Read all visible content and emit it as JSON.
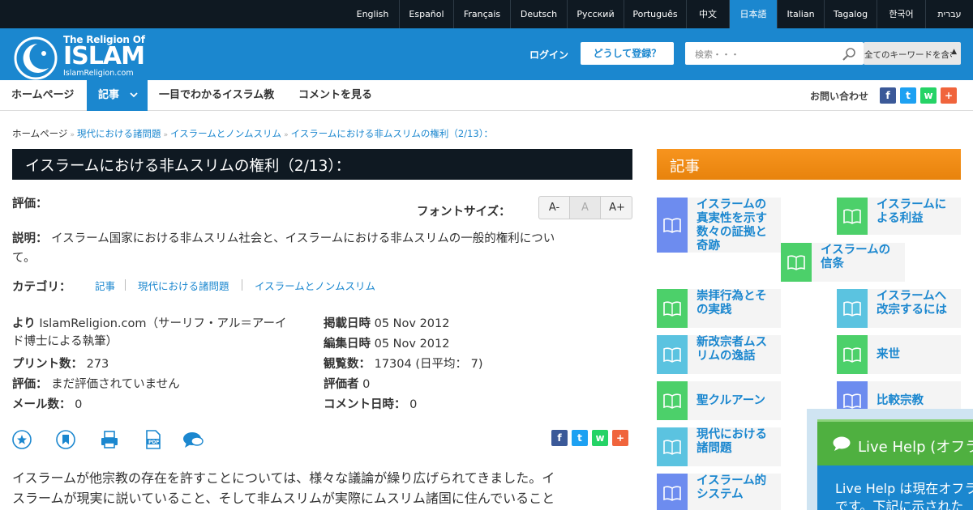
{
  "lang_bar": {
    "languages": [
      {
        "label": "English",
        "active": false
      },
      {
        "label": "Español",
        "active": false
      },
      {
        "label": "Français",
        "active": false
      },
      {
        "label": "Deutsch",
        "active": false
      },
      {
        "label": "Русский",
        "active": false
      },
      {
        "label": "Português",
        "active": false
      },
      {
        "label": "中文",
        "active": false
      },
      {
        "label": "日本語",
        "active": true
      },
      {
        "label": "Italian",
        "active": false
      },
      {
        "label": "Tagalog",
        "active": false
      },
      {
        "label": "한국어",
        "active": false
      },
      {
        "label": "עברית",
        "active": false
      }
    ]
  },
  "header": {
    "logo_line1": "The Religion Of",
    "logo_line2": "ISLAM",
    "logo_line3": "IslamReligion.com",
    "login": "ログイン",
    "register": "どうして登録？",
    "search_placeholder": "検索・・・",
    "search_scope": "全てのキーワードを含む"
  },
  "nav": {
    "home": "ホームページ",
    "articles": "記事",
    "glance": "一目でわかるイスラム教",
    "comments": "コメントを見る",
    "contact": "お問い合わせ"
  },
  "breadcrumb": {
    "home": "ホームページ",
    "c1": "現代における諸問題",
    "c2": "イスラームとノンムスリム",
    "c3": "イスラームにおける非ムスリムの権利（2/13）："
  },
  "article": {
    "title": "イスラームにおける非ムスリムの権利（2/13）：",
    "rating_label": "評価：",
    "font_size_label": "フォントサイズ：",
    "font_buttons": [
      "A-",
      "A",
      "A+"
    ],
    "desc_label": "説明：",
    "desc_line1": "イスラーム国家における非ムスリム社会と、イスラームにおける非ムスリムの一般的権利につい",
    "desc_line2": "て。",
    "category_label": "カテゴリ：",
    "categories": [
      "記事",
      "現代における諸問題",
      "イスラームとノンムスリム"
    ],
    "by_label": "より",
    "by_value": "IslamReligion.com（サーリフ・アル＝アーイ",
    "by_value2": "ド博士による執筆）",
    "printed_label": "プリント数：",
    "printed_value": "273",
    "rated_label": "評価：",
    "rated_value": "まだ評価されていません",
    "emailed_label": "メール数：",
    "emailed_value": "0",
    "published_label": "掲載日時",
    "published_value": "05 Nov 2012",
    "modified_label": "編集日時",
    "modified_value": "05 Nov 2012",
    "viewed_label": "観覧数：",
    "viewed_value": "17304 (日平均： 7)",
    "raters_label": "評価者",
    "raters_value": "0",
    "commented_label": "コメント日時：",
    "commented_value": "0",
    "body_line1": "イスラームが他宗教の存在を許すことについては、様々な議論が繰り広げられてきました。イ",
    "body_line2": "スラームが現実に説いていること、そして非ムスリムが実際にムスリム諸国に住んでいること"
  },
  "sidebar": {
    "header": "記事",
    "cards": [
      {
        "lines": [
          "イスラームの",
          "真実性を示す",
          "数々の証拠と",
          "奇跡"
        ],
        "icon": "book-icon",
        "color": "#6d8cef"
      },
      {
        "lines": [
          "イスラームに",
          "よる利益"
        ],
        "icon": "book-icon",
        "color": "#4cd06a"
      },
      {
        "lines": [
          "イスラームの",
          "信条"
        ],
        "icon": "book-icon",
        "color": "#4cd06a"
      },
      {
        "lines": [
          "崇拝行為とそ",
          "の実践"
        ],
        "icon": "book-icon",
        "color": "#4cd06a"
      },
      {
        "lines": [
          "イスラームへ",
          "改宗するには"
        ],
        "icon": "book-icon",
        "color": "#5bc3e0"
      },
      {
        "lines": [
          "新改宗者ムス",
          "リムの逸話"
        ],
        "icon": "book-icon",
        "color": "#5bc3e0"
      },
      {
        "lines": [
          "来世"
        ],
        "icon": "book-icon",
        "color": "#4cd06a"
      },
      {
        "lines": [
          "聖クルアーン"
        ],
        "icon": "book-icon",
        "color": "#4cd06a"
      },
      {
        "lines": [
          "比較宗教"
        ],
        "icon": "book-icon",
        "color": "#6d8cef"
      },
      {
        "lines": [
          "現代における",
          "諸問題"
        ],
        "icon": "book-icon",
        "color": "#5bc3e0"
      },
      {
        "lines": [
          "イスラーム的",
          "システム"
        ],
        "icon": "book-icon",
        "color": "#6d8cef"
      }
    ]
  },
  "live_help": {
    "title": "Live Help (オフライン)",
    "line1": "Live Help は現在オフラ",
    "line2": "です。下記に示された"
  },
  "colors": {
    "primary": "#1b87cf",
    "dark": "#0f1922",
    "orange": "#f7941e",
    "green": "#4fb040"
  }
}
